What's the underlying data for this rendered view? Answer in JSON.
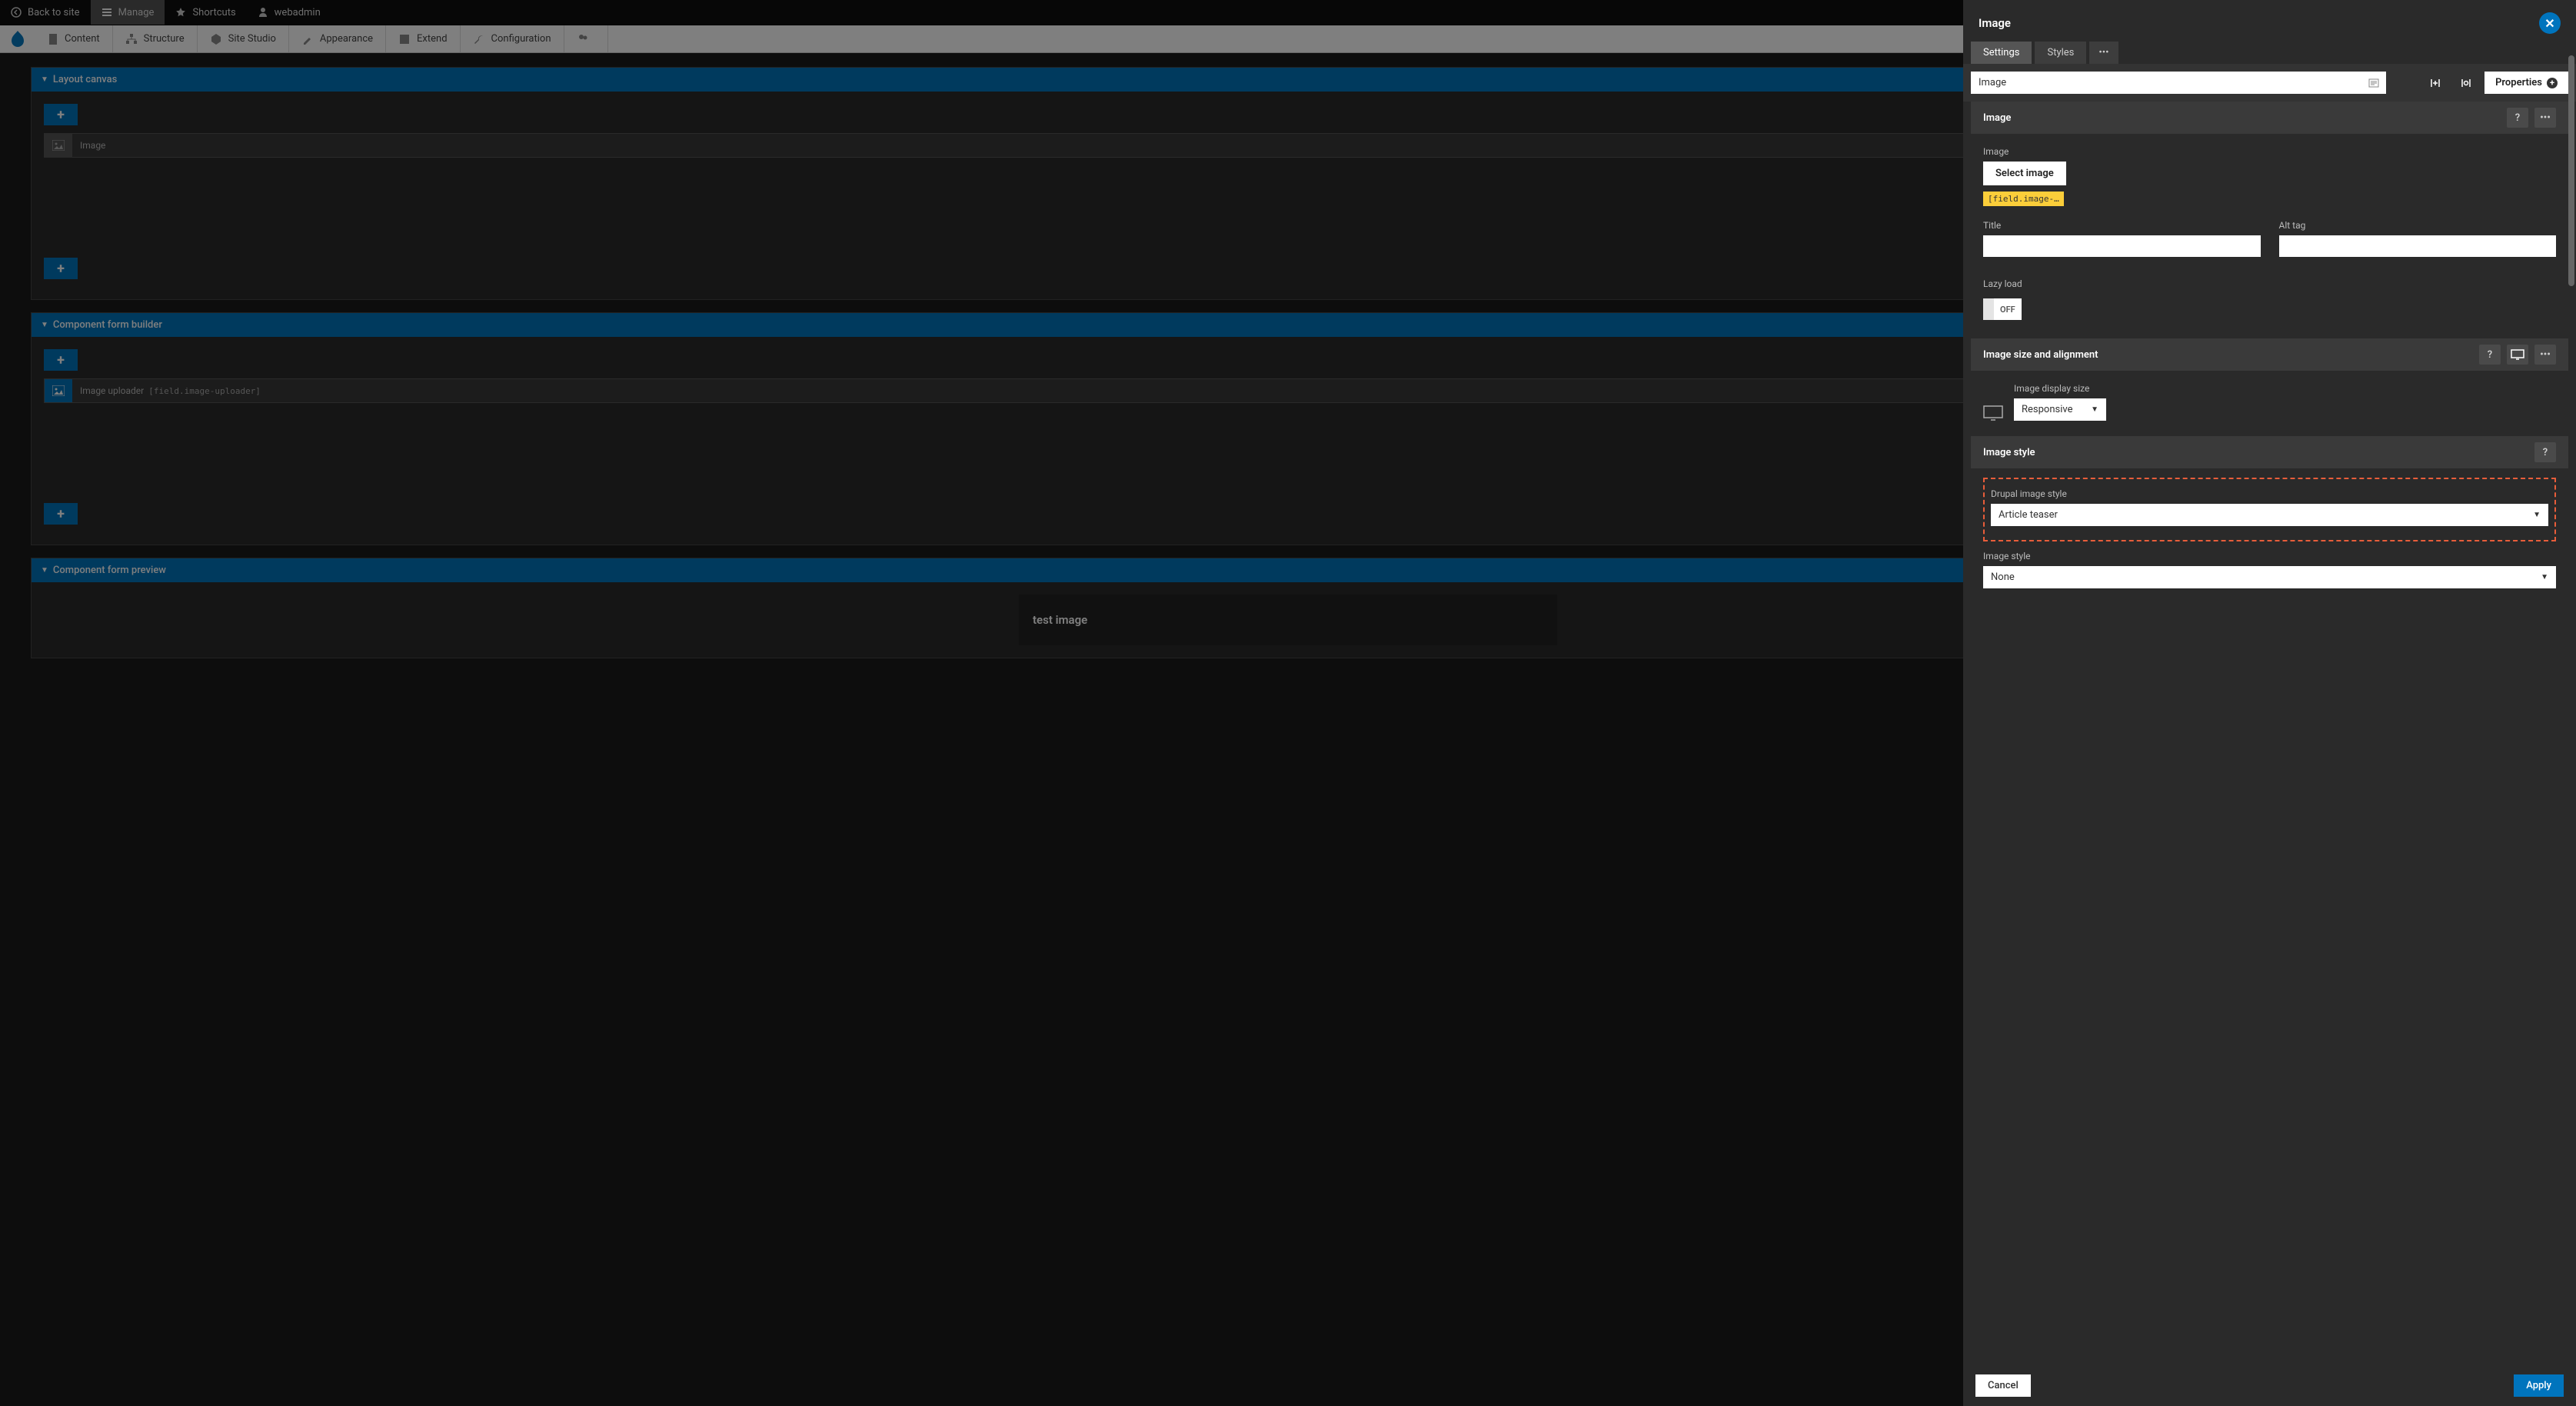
{
  "topbar": {
    "back": "Back to site",
    "manage": "Manage",
    "shortcuts": "Shortcuts",
    "user": "webadmin"
  },
  "nav": {
    "content": "Content",
    "structure": "Structure",
    "sitestudio": "Site Studio",
    "appearance": "Appearance",
    "extend": "Extend",
    "configuration": "Configuration"
  },
  "panels": {
    "layout": "Layout canvas",
    "layout_item": "Image",
    "builder": "Component form builder",
    "builder_item": "Image uploader",
    "builder_token": "[field.image-uploader]",
    "preview": "Component form preview",
    "preview_text": "test image"
  },
  "drawer": {
    "title": "Image",
    "tabs": {
      "settings": "Settings",
      "styles": "Styles"
    },
    "name_value": "Image",
    "properties": "Properties",
    "sec_image": "Image",
    "image_label": "Image",
    "select_image": "Select image",
    "token": "[field.image-…",
    "title_label": "Title",
    "alt_label": "Alt tag",
    "lazy_label": "Lazy load",
    "lazy_value": "OFF",
    "sec_size": "Image size and alignment",
    "display_size_label": "Image display size",
    "display_size_value": "Responsive",
    "sec_style": "Image style",
    "drupal_style_label": "Drupal image style",
    "drupal_style_value": "Article teaser",
    "image_style_label": "Image style",
    "image_style_value": "None",
    "cancel": "Cancel",
    "apply": "Apply"
  }
}
